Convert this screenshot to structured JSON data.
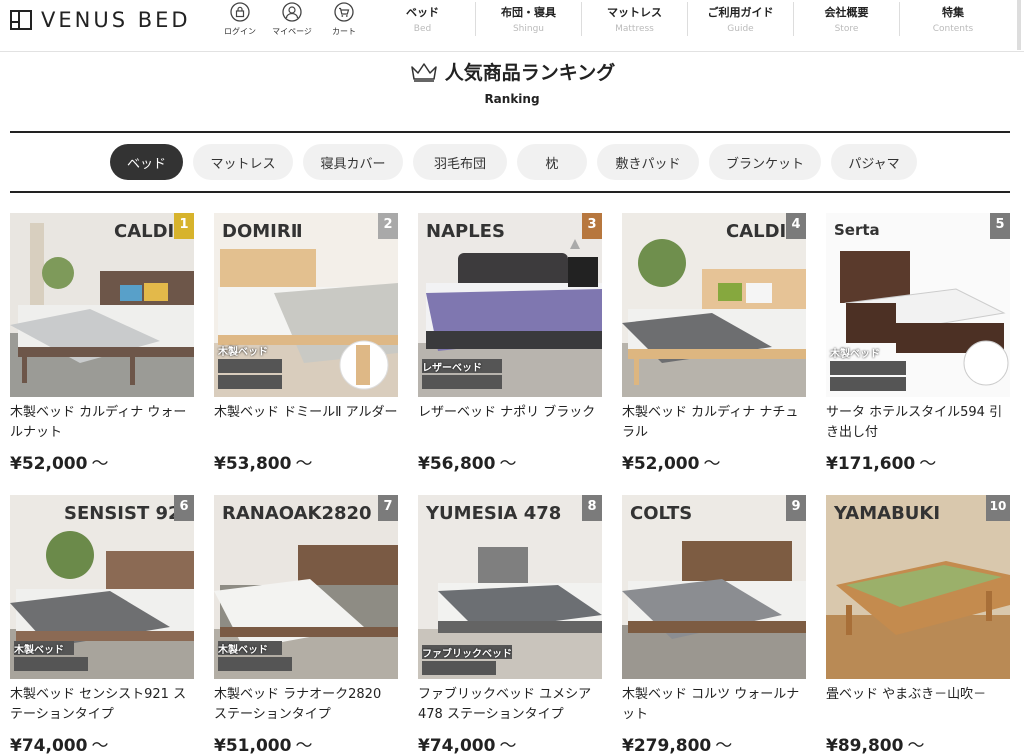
{
  "brand": {
    "name": "VENUS BED"
  },
  "header_icons": [
    {
      "icon": "lock-icon",
      "label": "ログイン"
    },
    {
      "icon": "user-icon",
      "label": "マイページ"
    },
    {
      "icon": "cart-icon",
      "label": "カート"
    }
  ],
  "nav": [
    {
      "jp": "ベッド",
      "en": "Bed"
    },
    {
      "jp": "布団・寝具",
      "en": "Shingu"
    },
    {
      "jp": "マットレス",
      "en": "Mattress"
    },
    {
      "jp": "ご利用ガイド",
      "en": "Guide"
    },
    {
      "jp": "会社概要",
      "en": "Store"
    },
    {
      "jp": "特集",
      "en": "Contents"
    }
  ],
  "ranking": {
    "title": "人気商品ランキング",
    "subtitle": "Ranking",
    "icon": "crown-icon"
  },
  "tabs": [
    {
      "label": "ベッド",
      "active": true
    },
    {
      "label": "マットレス",
      "active": false
    },
    {
      "label": "寝具カバー",
      "active": false
    },
    {
      "label": "羽毛布団",
      "active": false
    },
    {
      "label": "枕",
      "active": false
    },
    {
      "label": "敷きパッド",
      "active": false
    },
    {
      "label": "ブランケット",
      "active": false
    },
    {
      "label": "パジャマ",
      "active": false
    }
  ],
  "products": [
    {
      "rank": "1",
      "image_title": "CALDIN",
      "image_tag": "",
      "name": "木製ベッド カルディナ ウォールナット",
      "price": "¥52,000",
      "tilde": "〜",
      "badge_color": "#d7b32c"
    },
    {
      "rank": "2",
      "image_title": "DOMIRⅡ",
      "image_tag": "木製ベッド",
      "name": "木製ベッド ドミールⅡ アルダー",
      "price": "¥53,800",
      "tilde": "〜",
      "badge_color": "#a9a9a9"
    },
    {
      "rank": "3",
      "image_title": "NAPLES",
      "image_tag": "レザーベッド",
      "name": "レザーベッド ナポリ ブラック",
      "price": "¥56,800",
      "tilde": "〜",
      "badge_color": "#b7773e"
    },
    {
      "rank": "4",
      "image_title": "CALDIN",
      "image_tag": "",
      "name": "木製ベッド カルディナ ナチュラル",
      "price": "¥52,000",
      "tilde": "〜",
      "badge_color": "#7b7b7b"
    },
    {
      "rank": "5",
      "image_title": "Serta",
      "image_tag": "木製ベッド",
      "name": "サータ ホテルスタイル594 引き出し付",
      "price": "¥171,600",
      "tilde": "〜",
      "badge_color": "#7b7b7b"
    },
    {
      "rank": "6",
      "image_title": "SENSIST 92",
      "image_tag": "木製ベッド",
      "name": "木製ベッド センシスト921 ステーションタイプ",
      "price": "¥74,000",
      "tilde": "〜",
      "badge_color": "#7b7b7b"
    },
    {
      "rank": "7",
      "image_title": "RANAOAK2820",
      "image_tag": "木製ベッド",
      "name": "木製ベッド ラナオーク2820 ステーションタイプ",
      "price": "¥51,000",
      "tilde": "〜",
      "badge_color": "#7b7b7b"
    },
    {
      "rank": "8",
      "image_title": "YUMESIA 478",
      "image_tag": "ファブリックベッド",
      "name": "ファブリックベッド ユメシア478 ステーションタイプ",
      "price": "¥74,000",
      "tilde": "〜",
      "badge_color": "#7b7b7b"
    },
    {
      "rank": "9",
      "image_title": "COLTS",
      "image_tag": "",
      "name": "木製ベッド コルツ ウォールナット",
      "price": "¥279,800",
      "tilde": "〜",
      "badge_color": "#7b7b7b"
    },
    {
      "rank": "10",
      "image_title": "YAMABUKI",
      "image_tag": "",
      "name": "畳ベッド やまぶき－山吹－",
      "price": "¥89,800",
      "tilde": "〜",
      "badge_color": "#7b7b7b"
    }
  ]
}
